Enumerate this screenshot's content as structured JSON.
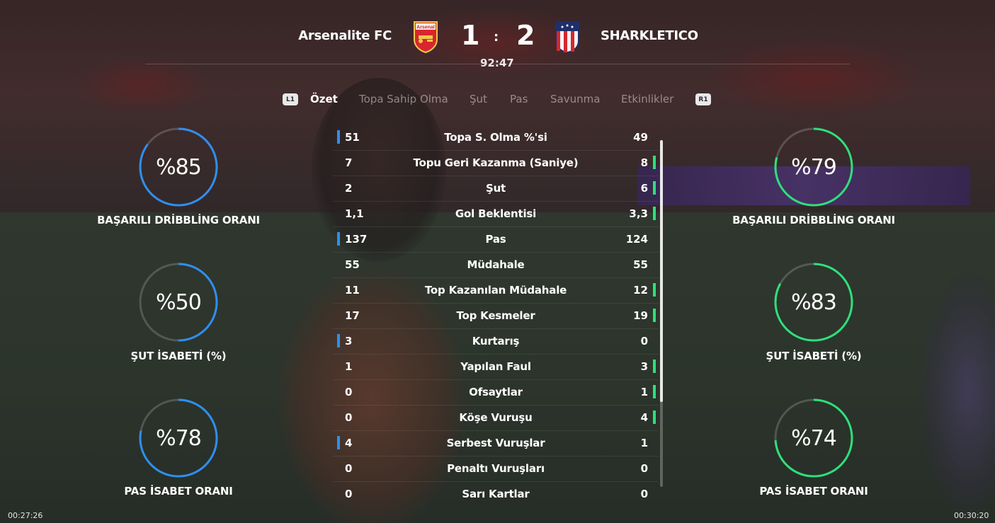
{
  "header": {
    "home_team": "Arsenalite FC",
    "away_team": "SHARKLETICO",
    "home_score": "1",
    "away_score": "2",
    "separator": ":",
    "clock": "92:47",
    "home_crest_text": "Arsenal"
  },
  "tabs": {
    "left_shoulder": "L1",
    "right_shoulder": "R1",
    "items": [
      "Özet",
      "Topa Sahip Olma",
      "Şut",
      "Pas",
      "Savunma",
      "Etkinlikler"
    ],
    "active": "Özet"
  },
  "home_rings": [
    {
      "value": "%85",
      "percent": 85,
      "label": "BAŞARILI DRİBBLİNG ORANI"
    },
    {
      "value": "%50",
      "percent": 50,
      "label": "ŞUT İSABETİ (%)"
    },
    {
      "value": "%78",
      "percent": 78,
      "label": "PAS İSABET ORANI"
    }
  ],
  "away_rings": [
    {
      "value": "%79",
      "percent": 79,
      "label": "BAŞARILI DRİBBLİNG ORANI"
    },
    {
      "value": "%83",
      "percent": 83,
      "label": "ŞUT İSABETİ (%)"
    },
    {
      "value": "%74",
      "percent": 74,
      "label": "PAS İSABET ORANI"
    }
  ],
  "stats": [
    {
      "label": "Topa S. Olma %'si",
      "home": "51",
      "away": "49",
      "leader": "home"
    },
    {
      "label": "Topu Geri Kazanma (Saniye)",
      "home": "7",
      "away": "8",
      "leader": "away"
    },
    {
      "label": "Şut",
      "home": "2",
      "away": "6",
      "leader": "away"
    },
    {
      "label": "Gol Beklentisi",
      "home": "1,1",
      "away": "3,3",
      "leader": "away"
    },
    {
      "label": "Pas",
      "home": "137",
      "away": "124",
      "leader": "home"
    },
    {
      "label": "Müdahale",
      "home": "55",
      "away": "55",
      "leader": "none"
    },
    {
      "label": "Top Kazanılan Müdahale",
      "home": "11",
      "away": "12",
      "leader": "away"
    },
    {
      "label": "Top Kesmeler",
      "home": "17",
      "away": "19",
      "leader": "away"
    },
    {
      "label": "Kurtarış",
      "home": "3",
      "away": "0",
      "leader": "home"
    },
    {
      "label": "Yapılan Faul",
      "home": "1",
      "away": "3",
      "leader": "away"
    },
    {
      "label": "Ofsaytlar",
      "home": "0",
      "away": "1",
      "leader": "away"
    },
    {
      "label": "Köşe Vuruşu",
      "home": "0",
      "away": "4",
      "leader": "away"
    },
    {
      "label": "Serbest Vuruşlar",
      "home": "4",
      "away": "1",
      "leader": "home"
    },
    {
      "label": "Penaltı Vuruşları",
      "home": "0",
      "away": "0",
      "leader": "none"
    },
    {
      "label": "Sarı Kartlar",
      "home": "0",
      "away": "0",
      "leader": "none"
    }
  ],
  "timestamps": {
    "left": "00:27:26",
    "right": "00:30:20"
  },
  "colors": {
    "home_accent": "#2e8ff0",
    "away_accent": "#2ee07a"
  }
}
